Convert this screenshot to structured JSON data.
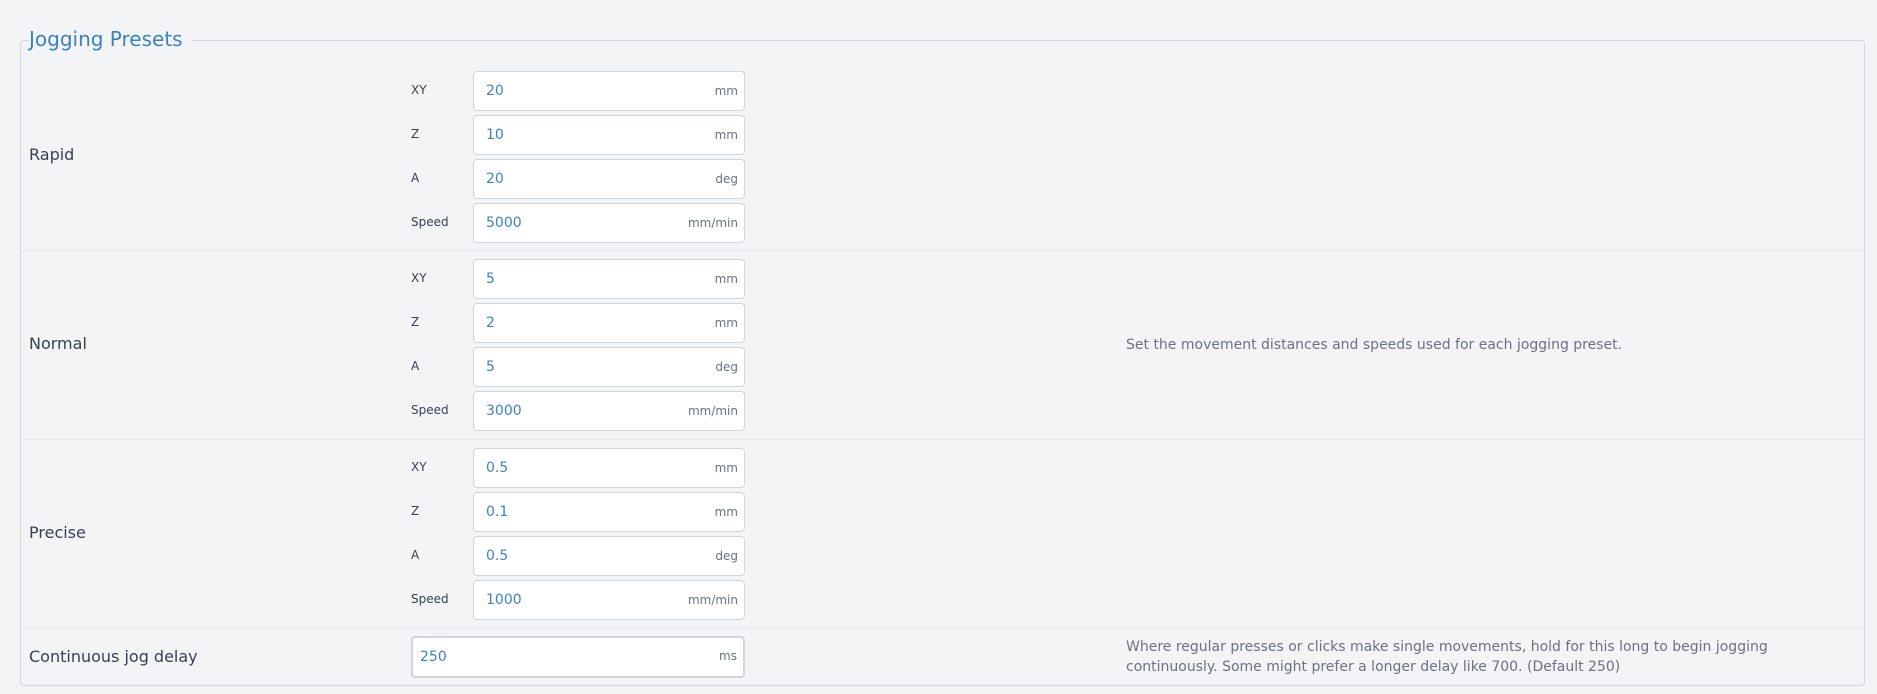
{
  "title": "Jogging Presets",
  "presets": [
    {
      "label": "Rapid",
      "fields": [
        {
          "label": "XY",
          "value": "20",
          "unit": "mm"
        },
        {
          "label": "Z",
          "value": "10",
          "unit": "mm"
        },
        {
          "label": "A",
          "value": "20",
          "unit": "deg"
        },
        {
          "label": "Speed",
          "value": "5000",
          "unit": "mm/min"
        }
      ]
    },
    {
      "label": "Normal",
      "fields": [
        {
          "label": "XY",
          "value": "5",
          "unit": "mm"
        },
        {
          "label": "Z",
          "value": "2",
          "unit": "mm"
        },
        {
          "label": "A",
          "value": "5",
          "unit": "deg"
        },
        {
          "label": "Speed",
          "value": "3000",
          "unit": "mm/min"
        }
      ]
    },
    {
      "label": "Precise",
      "fields": [
        {
          "label": "XY",
          "value": "0.5",
          "unit": "mm"
        },
        {
          "label": "Z",
          "value": "0.1",
          "unit": "mm"
        },
        {
          "label": "A",
          "value": "0.5",
          "unit": "deg"
        },
        {
          "label": "Speed",
          "value": "1000",
          "unit": "mm/min"
        }
      ]
    }
  ],
  "presets_description": "Set the movement distances and speeds used for each jogging preset.",
  "continuous_jog": {
    "label": "Continuous jog delay",
    "value": "250",
    "unit": "ms",
    "description": "Where regular presses or clicks make single movements, hold for this long to begin jogging continuously. Some might prefer a longer delay like 700. (Default 250)"
  }
}
